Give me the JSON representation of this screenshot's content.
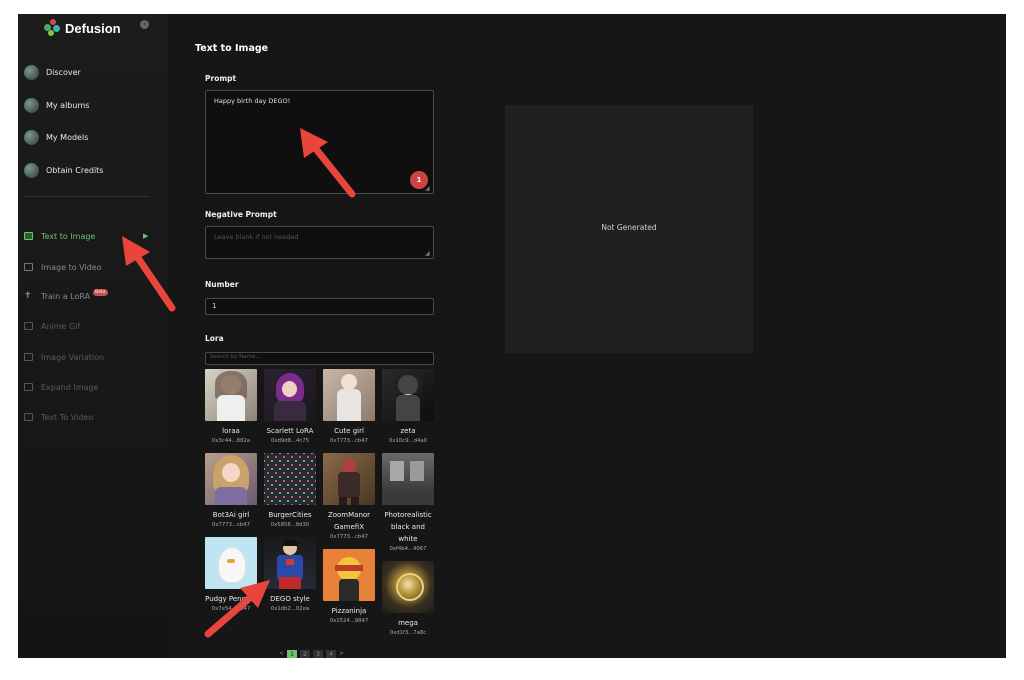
{
  "app": {
    "name": "Defusion"
  },
  "sidebar": {
    "nav": [
      {
        "label": "Discover",
        "icon": "planet-icon"
      },
      {
        "label": "My albums",
        "icon": "album-icon"
      },
      {
        "label": "My Models",
        "icon": "model-icon"
      },
      {
        "label": "Obtain Credits",
        "icon": "credits-icon"
      }
    ],
    "tools": [
      {
        "label": "Text to Image",
        "state": "active"
      },
      {
        "label": "Image to Video",
        "state": "normal"
      },
      {
        "label": "Train a LoRA",
        "state": "normal",
        "badge": "Beta"
      },
      {
        "label": "Anime Gif",
        "state": "disabled"
      },
      {
        "label": "Image Variation",
        "state": "disabled"
      },
      {
        "label": "Expand Image",
        "state": "disabled"
      },
      {
        "label": "Text To Video",
        "state": "disabled"
      }
    ]
  },
  "main": {
    "title": "Text to Image",
    "prompt": {
      "label": "Prompt",
      "value": "Happy birth day DEGO!",
      "grammar_count": "1"
    },
    "negative": {
      "label": "Negative Prompt",
      "placeholder": "Leave blank if not needed"
    },
    "number": {
      "label": "Number",
      "value": "1"
    },
    "lora": {
      "label": "Lora",
      "search_placeholder": "Search by Name...",
      "items": [
        {
          "name": "loraa",
          "addr": "0x3c44...882a"
        },
        {
          "name": "Scarlett LoRA",
          "addr": "0xd9d8...4c75"
        },
        {
          "name": "Cute girl",
          "addr": "0x7773...cb47"
        },
        {
          "name": "zeta",
          "addr": "0x10c9...d4a0"
        },
        {
          "name": "Bot3Ai girl",
          "addr": "0x7773...cb47"
        },
        {
          "name": "BurgerCities",
          "addr": "0x5858...8d30"
        },
        {
          "name": "ZoomManor GamefiX",
          "addr": "0x7773...cb47"
        },
        {
          "name": "Photorealistic black and white",
          "addr": "0xf4b4...4067"
        },
        {
          "name": "Pudgy Penguin",
          "addr": "0x7e54...9847"
        },
        {
          "name": "DEGO style",
          "addr": "0x1db2...02ea"
        },
        {
          "name": "Pizzaninja",
          "addr": "0x1524...9847"
        },
        {
          "name": "mega",
          "addr": "0xd1f3...7a8c"
        }
      ]
    },
    "pagination": {
      "prev": "<",
      "pages": [
        "1",
        "2",
        "3",
        "4"
      ],
      "next": ">"
    }
  },
  "preview": {
    "status": "Not Generated"
  },
  "colors": {
    "accent": "#67c56b",
    "annotation_arrow": "#e8453c",
    "background": "#161616"
  }
}
